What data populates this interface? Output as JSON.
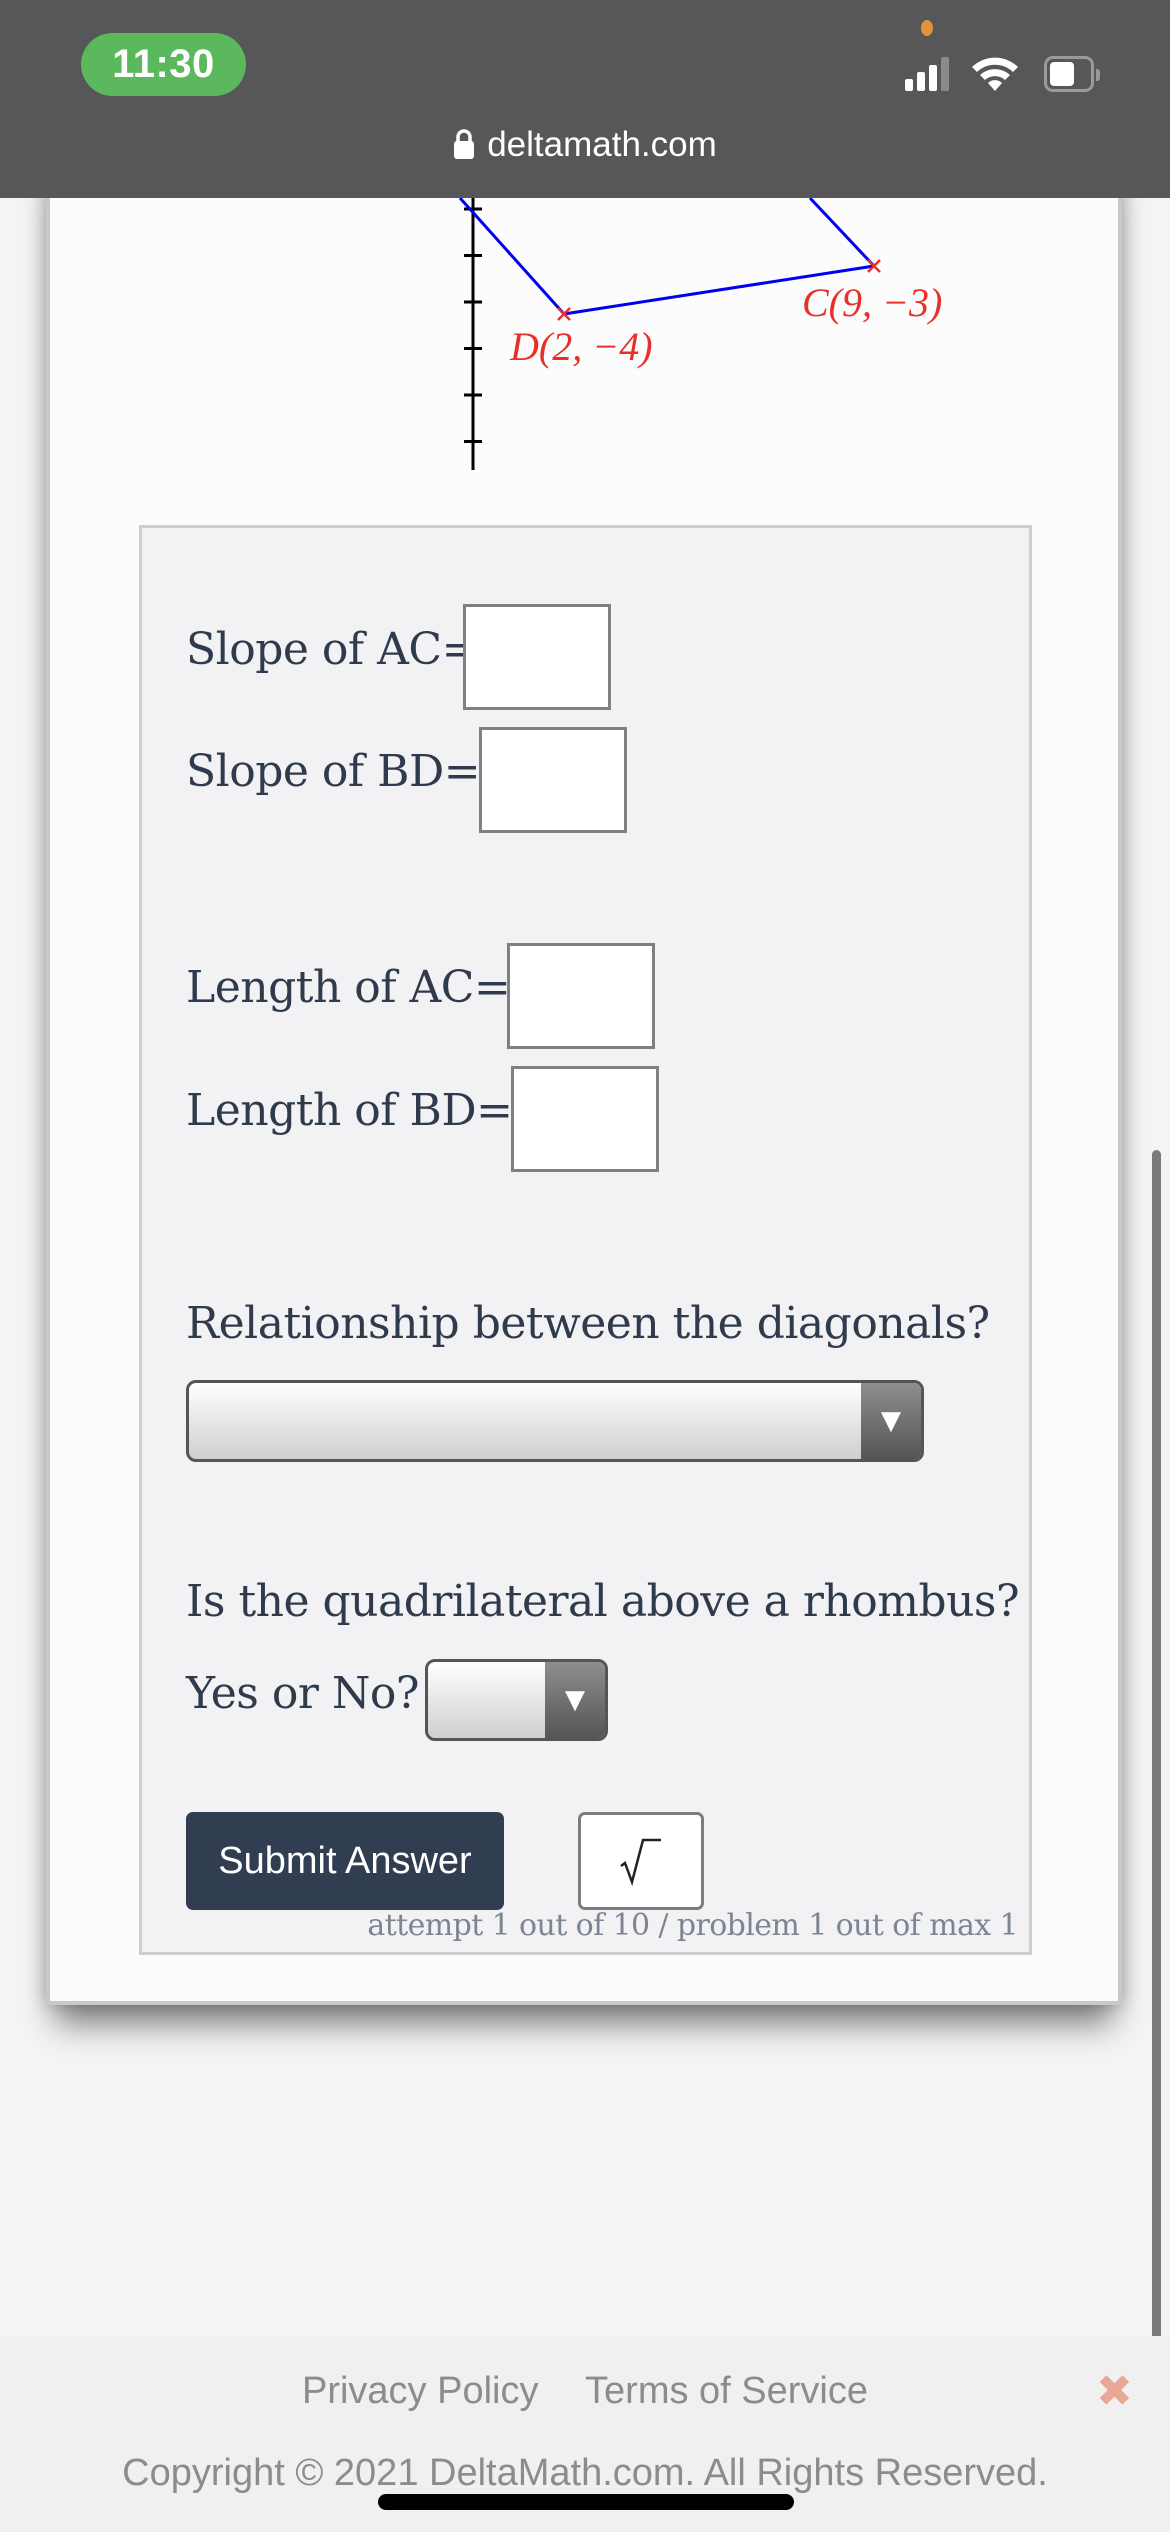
{
  "status_bar": {
    "time": "11:30"
  },
  "browser": {
    "url": "deltamath.com"
  },
  "graph": {
    "points": [
      {
        "name": "C",
        "label": "C(9, −3)",
        "x": 9,
        "y": -3
      },
      {
        "name": "D",
        "label": "D(2, −4)",
        "x": 2,
        "y": -4
      }
    ],
    "line_color": "#0000ee",
    "point_color": "#e8302a"
  },
  "questions": {
    "slope_ac_label": "Slope of AC=",
    "slope_bd_label": "Slope of BD=",
    "length_ac_label": "Length of AC=",
    "length_bd_label": "Length of BD=",
    "slope_ac_value": "",
    "slope_bd_value": "",
    "length_ac_value": "",
    "length_bd_value": "",
    "diagonals_question": "Relationship between the diagonals?",
    "diagonals_selected": "",
    "rhombus_question": "Is the quadrilateral above a rhombus?",
    "yes_no_label": "Yes or No?",
    "yes_no_selected": ""
  },
  "actions": {
    "submit_label": "Submit Answer",
    "sqrt_symbol": "√",
    "attempt_text": "attempt 1 out of 10 / problem 1 out of max 1"
  },
  "footer": {
    "privacy_label": "Privacy Policy",
    "terms_label": "Terms of Service",
    "close_symbol": "✖",
    "copyright": "Copyright © 2021 DeltaMath.com. All Rights Reserved."
  }
}
